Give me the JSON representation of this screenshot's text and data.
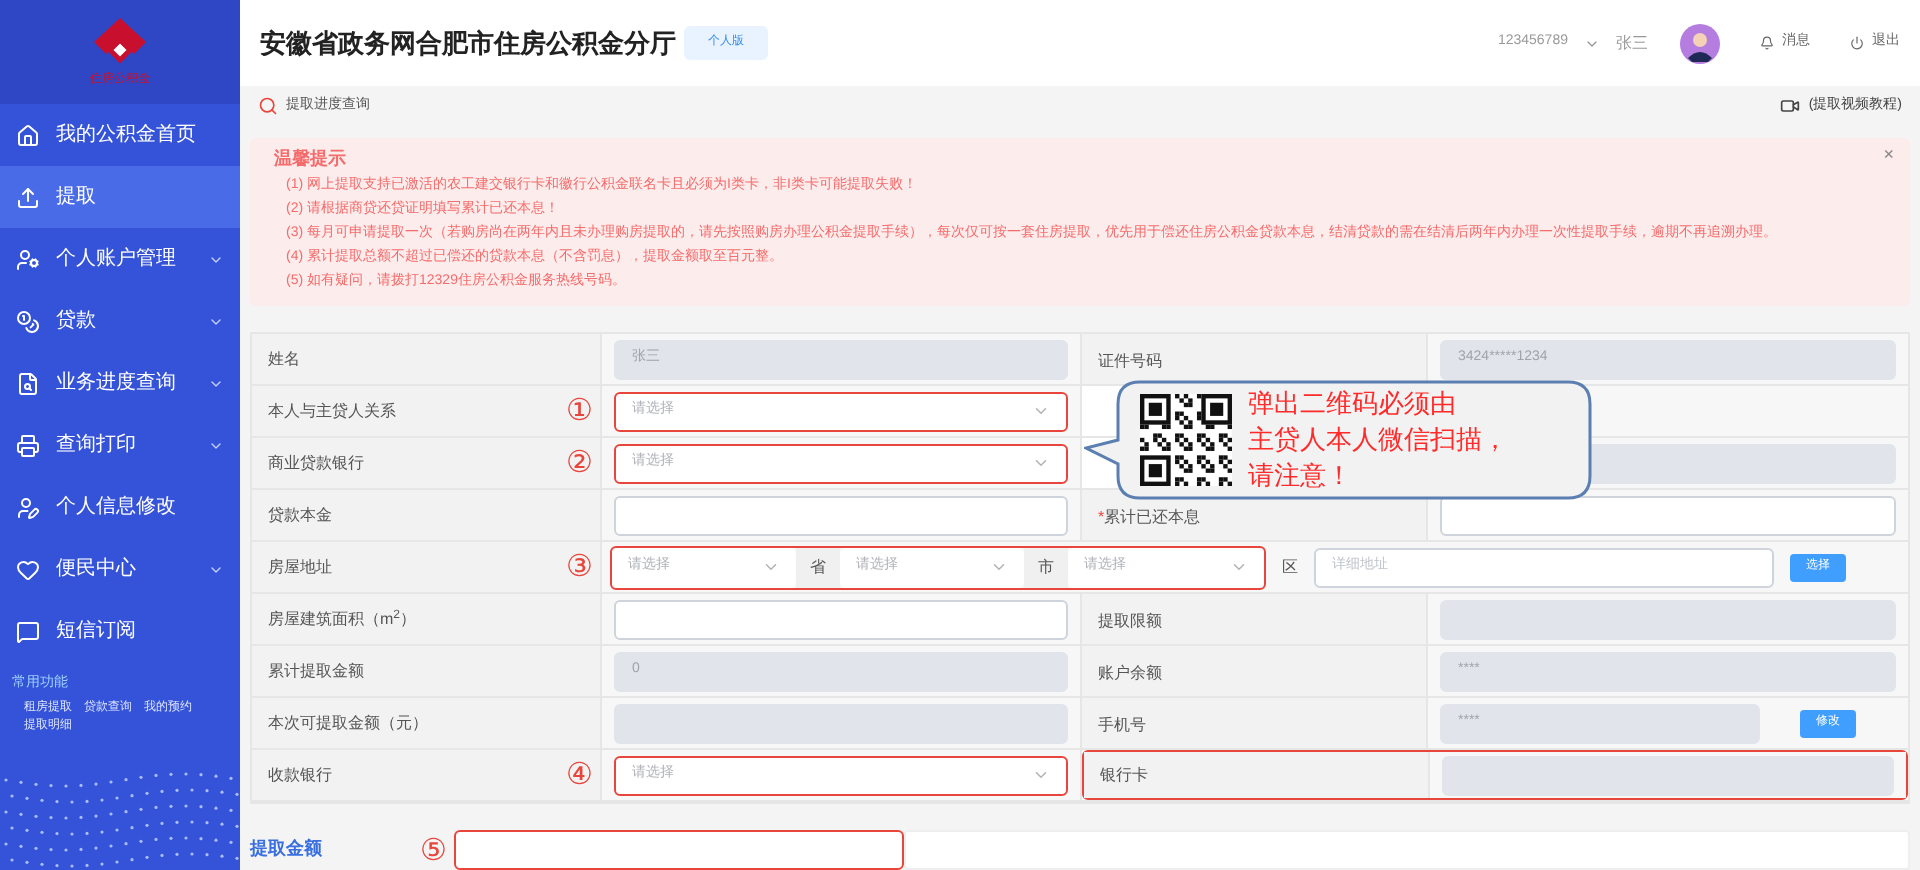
{
  "sidebar": {
    "logo_text": "住房公积金",
    "items": [
      {
        "label": "我的公积金首页",
        "expandable": false,
        "selected": false
      },
      {
        "label": "提取",
        "expandable": false,
        "selected": true
      },
      {
        "label": "个人账户管理",
        "expandable": true,
        "selected": false
      },
      {
        "label": "贷款",
        "expandable": true,
        "selected": false
      },
      {
        "label": "业务进度查询",
        "expandable": true,
        "selected": false
      },
      {
        "label": "查询打印",
        "expandable": true,
        "selected": false
      },
      {
        "label": "个人信息修改",
        "expandable": false,
        "selected": false
      },
      {
        "label": "便民中心",
        "expandable": true,
        "selected": false
      },
      {
        "label": "短信订阅",
        "expandable": false,
        "selected": false
      }
    ],
    "shortcuts_title": "常用功能",
    "shortcuts": [
      "租房提取",
      "贷款查询",
      "我的预约",
      "提取明细"
    ]
  },
  "header": {
    "title": "安徽省政务网合肥市住房公积金分厅",
    "badge": "个人版",
    "account": "123456789",
    "user": "张三",
    "messages": "消息",
    "logout": "退出"
  },
  "breadcrumb": {
    "label": "提取进度查询",
    "video_link": "(提取视频教程)"
  },
  "notice": {
    "title": "温馨提示",
    "lines": [
      "(1) 网上提取支持已激活的农工建交银行卡和徽行公积金联名卡且必须为I类卡，非I类卡可能提取失败！",
      "(2) 请根据商贷还贷证明填写累计已还本息！",
      "(3) 每月可申请提取一次（若购房尚在两年内且未办理购房提取的，请先按照购房办理公积金提取手续），每次仅可按一套住房提取，优先用于偿还住房公积金贷款本息，结清贷款的需在结清后两年内办理一次性提取手续，逾期不再追溯办理。",
      "(4) 累计提取总额不超过已偿还的贷款本息（不含罚息），提取金额取至百元整。",
      "(5) 如有疑问，请拨打12329住房公积金服务热线号码。"
    ],
    "close": "×"
  },
  "rows": [
    {
      "kind": "fields",
      "label": "姓名",
      "field": {
        "kind": "input",
        "value": "张三",
        "disabled": true
      },
      "right": {
        "label": "证件号码",
        "field": {
          "kind": "input",
          "value": "3424*****1234",
          "disabled": true
        }
      }
    },
    {
      "kind": "fields",
      "label": "本人与主贷人关系",
      "marker": "①",
      "field": {
        "kind": "select",
        "placeholder": "请选择",
        "highlighted": true
      }
    },
    {
      "kind": "fields",
      "label": "商业贷款银行",
      "marker": "②",
      "field": {
        "kind": "select",
        "placeholder": "请选择",
        "highlighted": true
      },
      "right": {
        "field": {
          "kind": "input",
          "disabled": true
        }
      }
    },
    {
      "kind": "fields",
      "label": "贷款本金",
      "field": {
        "kind": "input",
        "disabled": false
      },
      "right": {
        "label": "累计已还本息",
        "required_mark": "*",
        "field": {
          "kind": "input",
          "disabled": false
        }
      }
    },
    {
      "kind": "address",
      "label": "房屋地址",
      "marker": "③",
      "highlighted": true,
      "parts": [
        {
          "kind": "select",
          "placeholder": "请选择"
        },
        {
          "kind": "text",
          "text": "省"
        },
        {
          "kind": "select",
          "placeholder": "请选择"
        },
        {
          "kind": "text",
          "text": "市"
        },
        {
          "kind": "select",
          "placeholder": "请选择"
        }
      ],
      "district": "区",
      "detail": {
        "kind": "input",
        "placeholder": "详细地址",
        "disabled": false
      },
      "button": "选择"
    },
    {
      "kind": "fields",
      "label": "房屋建筑面积（m$^{2}$）",
      "field": {
        "kind": "input",
        "disabled": false
      },
      "right": {
        "label": "提取限额",
        "field": {
          "kind": "input",
          "disabled": true
        }
      }
    },
    {
      "kind": "fields",
      "label": "累计提取金额",
      "field": {
        "kind": "input",
        "value": "0",
        "disabled": true
      },
      "right": {
        "label": "账户余额",
        "field": {
          "kind": "input",
          "value": "****",
          "disabled": true
        }
      }
    },
    {
      "kind": "fields",
      "label": "本次可提取金额（元）",
      "field": {
        "kind": "input",
        "disabled": true
      },
      "right": {
        "label": "手机号",
        "field": {
          "kind": "input",
          "value": "****",
          "disabled": true
        },
        "button": "修改"
      }
    },
    {
      "kind": "fields",
      "label": "收款银行",
      "marker": "④",
      "field": {
        "kind": "select",
        "placeholder": "请选择",
        "highlighted": true
      },
      "right": {
        "label": "银行卡",
        "highlighted": true,
        "field": {
          "kind": "input",
          "disabled": true
        }
      }
    }
  ],
  "callout": {
    "lines": [
      "弹出二维码必须由",
      "主贷人本人微信扫描，",
      "请注意！"
    ]
  },
  "amount": {
    "label": "提取金额",
    "marker": "⑤",
    "highlighted": true
  }
}
